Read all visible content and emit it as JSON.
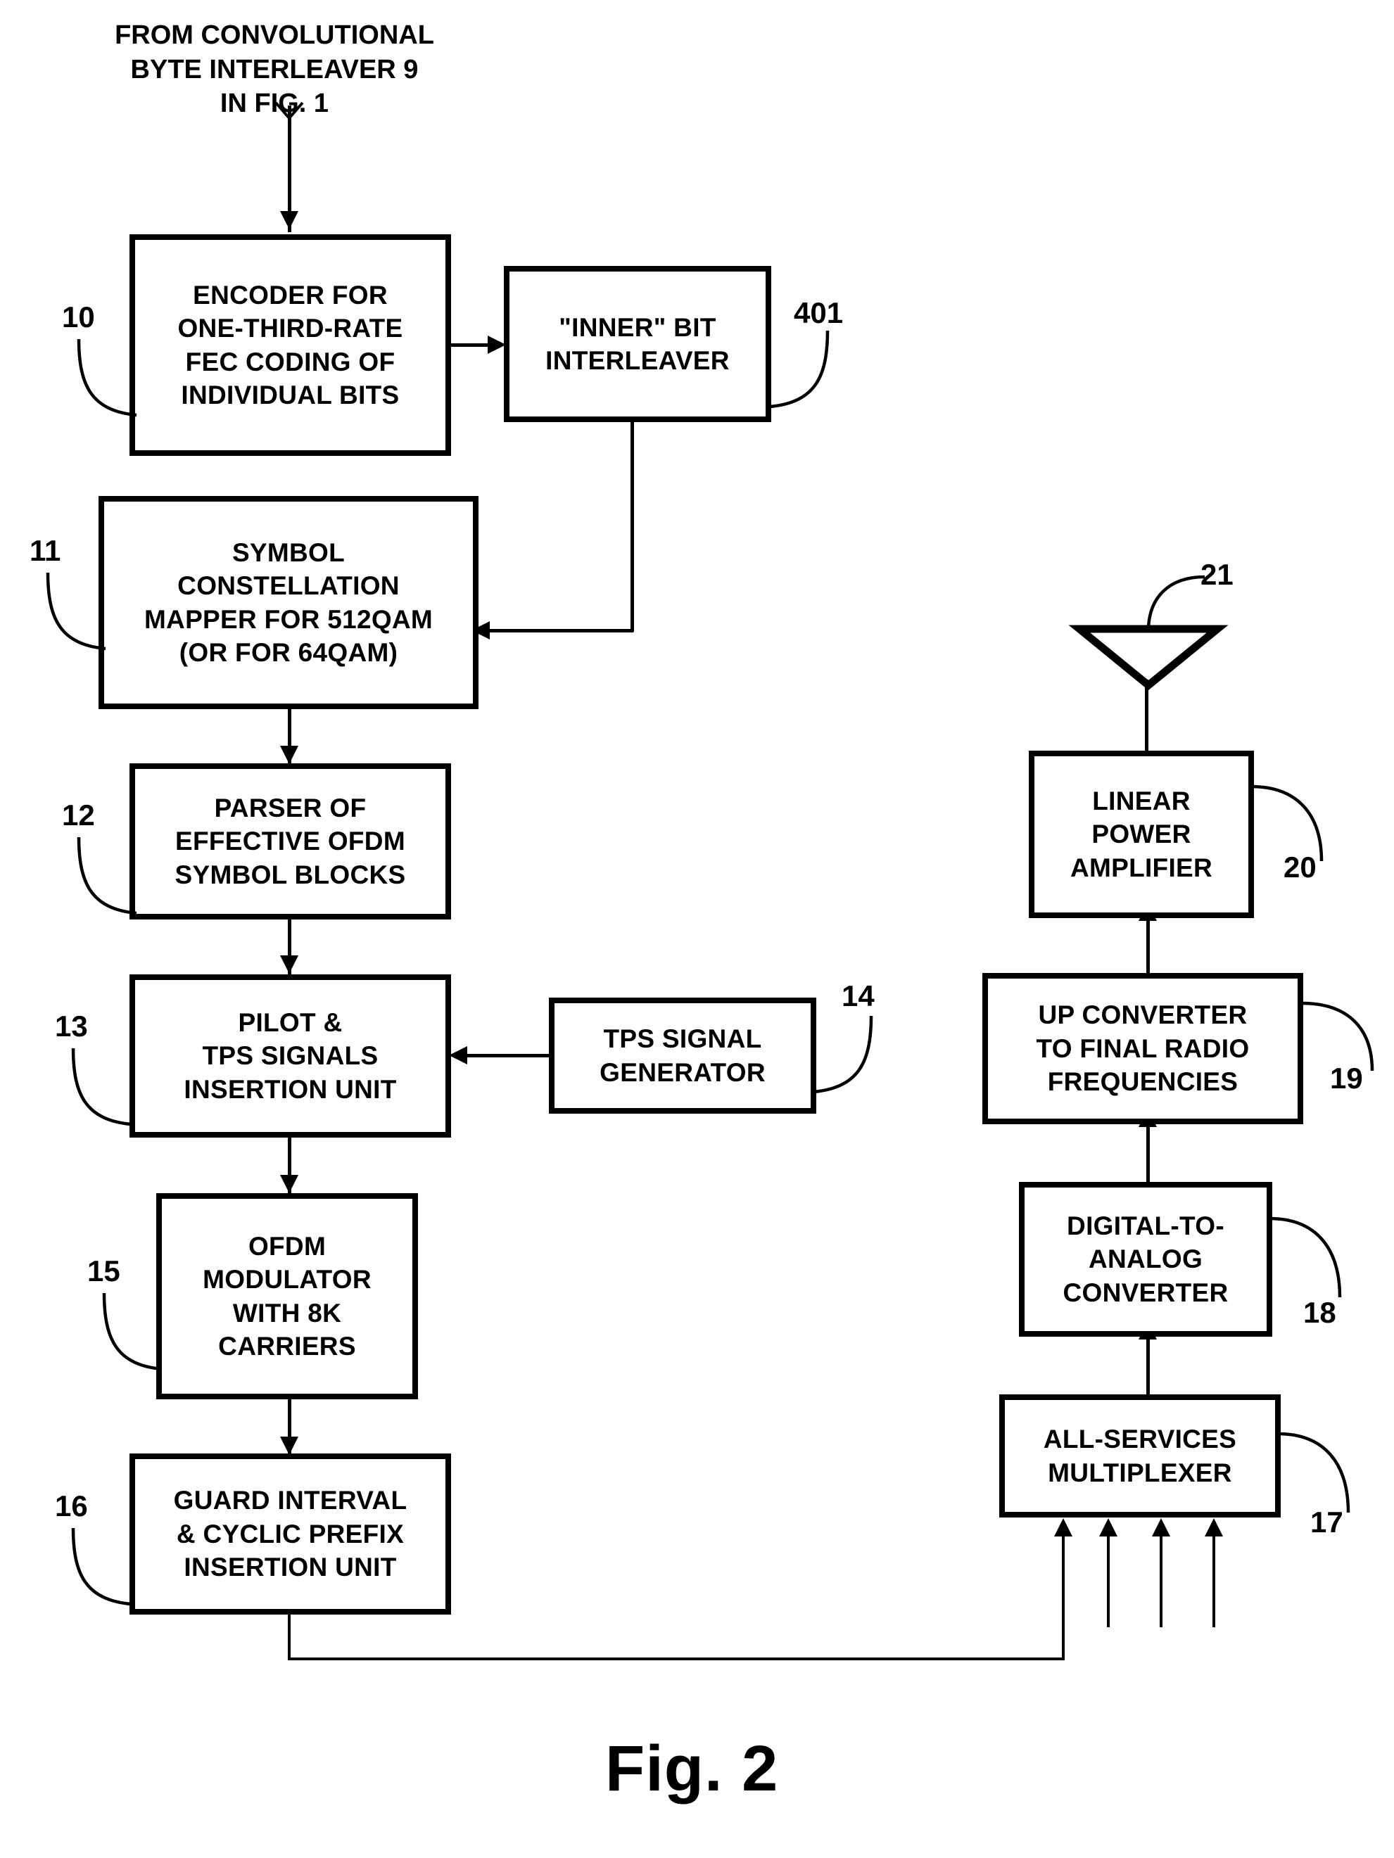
{
  "figure": {
    "label": "Fig. 2",
    "source_note": "FROM CONVOLUTIONAL\nBYTE INTERLEAVER 9\nIN FIG. 1"
  },
  "blocks": [
    {
      "id": "encoder",
      "ref": "10",
      "label": "ENCODER FOR\nONE-THIRD-RATE\nFEC CODING OF\nINDIVIDUAL BITS"
    },
    {
      "id": "interleaver",
      "ref": "401",
      "label": "\"INNER\" BIT\nINTERLEAVER"
    },
    {
      "id": "mapper",
      "ref": "11",
      "label": "SYMBOL\nCONSTELLATION\nMAPPER FOR 512QAM\n(OR FOR 64QAM)"
    },
    {
      "id": "parser",
      "ref": "12",
      "label": "PARSER OF\nEFFECTIVE OFDM\nSYMBOL BLOCKS"
    },
    {
      "id": "pilot",
      "ref": "13",
      "label": "PILOT &\nTPS SIGNALS\nINSERTION UNIT"
    },
    {
      "id": "tpsgen",
      "ref": "14",
      "label": "TPS SIGNAL\nGENERATOR"
    },
    {
      "id": "ofdmmod",
      "ref": "15",
      "label": "OFDM\nMODULATOR\nWITH 8K\nCARRIERS"
    },
    {
      "id": "guard",
      "ref": "16",
      "label": "GUARD INTERVAL\n& CYCLIC PREFIX\nINSERTION UNIT"
    },
    {
      "id": "mux",
      "ref": "17",
      "label": "ALL-SERVICES\nMULTIPLEXER"
    },
    {
      "id": "dac",
      "ref": "18",
      "label": "DIGITAL-TO-\nANALOG\nCONVERTER"
    },
    {
      "id": "upconv",
      "ref": "19",
      "label": "UP CONVERTER\nTO FINAL RADIO\nFREQUENCIES"
    },
    {
      "id": "amp",
      "ref": "20",
      "label": "LINEAR\nPOWER\nAMPLIFIER"
    },
    {
      "id": "antenna",
      "ref": "21",
      "label": "antenna-symbol"
    }
  ],
  "colors": {
    "stroke": "#000000",
    "background": "#ffffff"
  }
}
